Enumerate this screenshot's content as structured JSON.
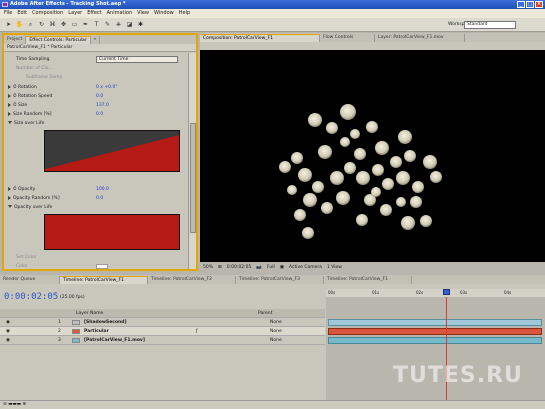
{
  "window": {
    "title": "Adobe After Effects - Tracking Shot.aep *"
  },
  "menu": [
    "File",
    "Edit",
    "Composition",
    "Layer",
    "Effect",
    "Animation",
    "View",
    "Window",
    "Help"
  ],
  "toolbar": {
    "workspace_label": "Workspace:",
    "workspace_value": "Standard"
  },
  "left_panel": {
    "tabs": [
      "Project",
      "Effect Controls: Particular",
      "»"
    ],
    "subheader": "PatrolCarView_F1 * Particular",
    "properties": [
      {
        "label": "Time Sampling",
        "value": "Current Time"
      },
      {
        "label": "Number of Clo...",
        "value": ""
      },
      {
        "label": "Subframe Samp",
        "value": ""
      },
      {
        "label": "Rotation",
        "value": "0 x +0.0°"
      },
      {
        "label": "Rotation Speed",
        "value": "0.0"
      },
      {
        "label": "Size",
        "value": "137.0"
      },
      {
        "label": "Size Random [%]",
        "value": "0.0"
      },
      {
        "label": "Size over Life",
        "value": ""
      },
      {
        "label": "Opacity",
        "value": "100.0"
      },
      {
        "label": "Opacity Random [%]",
        "value": "0.0"
      },
      {
        "label": "Opacity over Life",
        "value": ""
      },
      {
        "label": "Set Color",
        "value": ""
      },
      {
        "label": "Color",
        "value": ""
      }
    ]
  },
  "comp_panel": {
    "tabs": [
      "Composition: PatrolCarView_F1",
      "Flow Controls",
      "Layer: PatrolCarView_F1.mov"
    ],
    "viewer_bar": [
      "50%",
      "0:00:02:05",
      "Full",
      "Active Camera",
      "1 View"
    ]
  },
  "timeline": {
    "tabs": [
      "Render Queue",
      "Timeline: PatrolCarView_F1",
      "Timeline: PatrolCarView_F2",
      "Timeline: PatrolCarView_F3",
      "Timeline: PatrolCarView_F1"
    ],
    "timecode": "0:00:02:05",
    "fps": "(25.00 fps)",
    "columns": {
      "layer_name": "Layer Name",
      "parent": "Parent"
    },
    "ruler": [
      "00s",
      "01s",
      "02s",
      "03s",
      "04s"
    ],
    "layers": [
      {
        "num": "1",
        "name": "[ShadowSecond]",
        "parent": "None",
        "bar_color": "#9fc8d8"
      },
      {
        "num": "2",
        "name": "Particular",
        "parent": "None",
        "bar_color": "#d9553e"
      },
      {
        "num": "3",
        "name": "[PatrolCarView_F1.mov]",
        "parent": "None",
        "bar_color": "#76b9c8"
      }
    ]
  },
  "watermark": "TUTES.RU"
}
